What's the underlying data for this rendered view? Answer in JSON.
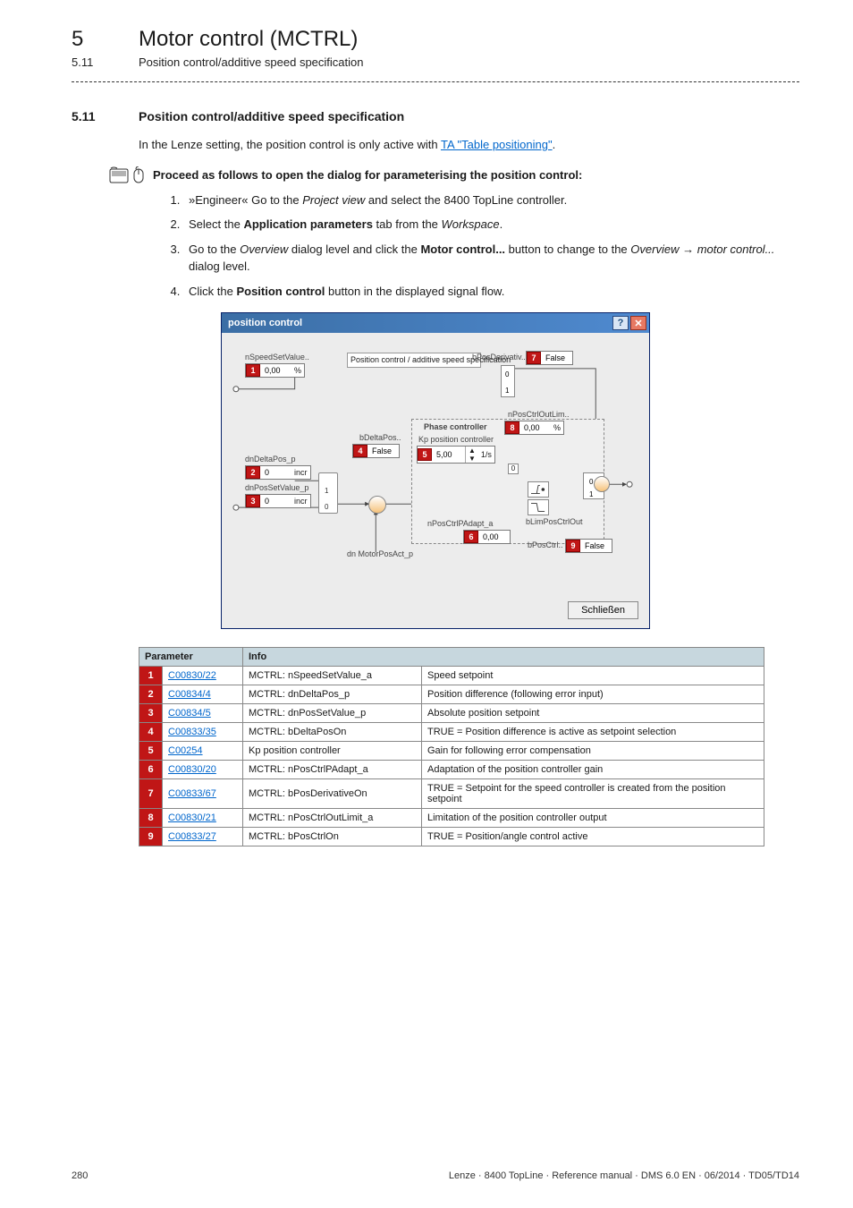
{
  "chapter": {
    "index": "5",
    "title": "Motor control (MCTRL)"
  },
  "subsection_ref": {
    "index": "5.11",
    "title": "Position control/additive speed specification"
  },
  "section": {
    "num": "5.11",
    "title": "Position control/additive speed specification"
  },
  "intro_prefix": "In the Lenze setting, the position control is only active with ",
  "intro_link": "TA \"Table positioning\"",
  "intro_suffix": ".",
  "proceed": "Proceed as follows to open the dialog for parameterising the position control:",
  "steps": {
    "s1a": "»Engineer« Go to the ",
    "s1b": "Project view",
    "s1c": " and select the 8400 TopLine controller.",
    "s2a": "Select the ",
    "s2b": "Application parameters",
    "s2c": " tab from the ",
    "s2d": "Workspace",
    "s2e": ".",
    "s3a": "Go to the ",
    "s3b": "Overview",
    "s3c": " dialog level and click the ",
    "s3d": "Motor control...",
    "s3e": " button to change to the ",
    "s3f": "Overview",
    "s3g": "motor control...",
    "s3h": " dialog level.",
    "s4a": "Click the ",
    "s4b": "Position control",
    "s4c": " button in the displayed signal flow."
  },
  "dialog": {
    "title": "position control",
    "close_btn": "Schließen",
    "lbl_heading": "Position control / additive\nspeed specification",
    "lbl_phase": "Phase controller",
    "lbl_kp": "Kp position controller",
    "lbl_dn": "dn MotorPosAct_p",
    "sig_nSpeedSetValue": "nSpeedSetValue..",
    "sig_dnDeltaPos": "dnDeltaPos_p",
    "sig_dnPosSetValue": "dnPosSetValue_p",
    "sig_bDeltaPos": "bDeltaPos..",
    "sig_nPosCtrlPAdapt": "nPosCtrlPAdapt_a",
    "sig_bPosDerivativ": "bPosDerivativ..",
    "sig_nPosCtrlOutLim": "nPosCtrlOutLim..",
    "sig_bLimPosCtrlOut": "bLimPosCtrlOut",
    "sig_bPosCtrl": "bPosCtrl..",
    "val_nSpeedSetValue": "0,00",
    "val_dnDeltaPos": "0",
    "val_dnPosSetValue": "0",
    "val_bDeltaPos": "False",
    "val_kp": "5,00",
    "val_kp_unit": "1/s",
    "val_nPosCtrlPAdapt": "0,00",
    "val_bPosDerivativ": "False",
    "val_nPosCtrlOutLim": "0,00",
    "val_bLimPosCtrlOut": "",
    "val_bPosCtrl": "False",
    "tag": {
      "t1": "1",
      "t2": "2",
      "t3": "3",
      "t4": "4",
      "t5": "5",
      "t6": "6",
      "t7": "7",
      "t8": "8",
      "t9": "9"
    },
    "unit_pct": "%",
    "unit_incr": "incr"
  },
  "table": {
    "h_param": "Parameter",
    "h_info": "Info",
    "rows": [
      {
        "n": "1",
        "code": "C00830/22",
        "name": "MCTRL: nSpeedSetValue_a",
        "desc": "Speed setpoint"
      },
      {
        "n": "2",
        "code": "C00834/4",
        "name": "MCTRL: dnDeltaPos_p",
        "desc": "Position difference (following error input)"
      },
      {
        "n": "3",
        "code": "C00834/5",
        "name": "MCTRL: dnPosSetValue_p",
        "desc": "Absolute position setpoint"
      },
      {
        "n": "4",
        "code": "C00833/35",
        "name": "MCTRL: bDeltaPosOn",
        "desc": "TRUE = Position difference is active as setpoint selection"
      },
      {
        "n": "5",
        "code": "C00254",
        "name": "Kp position controller",
        "desc": "Gain for following error compensation"
      },
      {
        "n": "6",
        "code": "C00830/20",
        "name": "MCTRL: nPosCtrlPAdapt_a",
        "desc": "Adaptation of the position controller gain"
      },
      {
        "n": "7",
        "code": "C00833/67",
        "name": "MCTRL: bPosDerivativeOn",
        "desc": "TRUE = Setpoint for the speed controller is created from the position setpoint"
      },
      {
        "n": "8",
        "code": "C00830/21",
        "name": "MCTRL: nPosCtrlOutLimit_a",
        "desc": "Limitation of the position controller output"
      },
      {
        "n": "9",
        "code": "C00833/27",
        "name": "MCTRL: bPosCtrlOn",
        "desc": "TRUE = Position/angle control active"
      }
    ]
  },
  "footer": {
    "page": "280",
    "meta": "Lenze · 8400 TopLine · Reference manual · DMS 6.0 EN · 06/2014 · TD05/TD14"
  }
}
